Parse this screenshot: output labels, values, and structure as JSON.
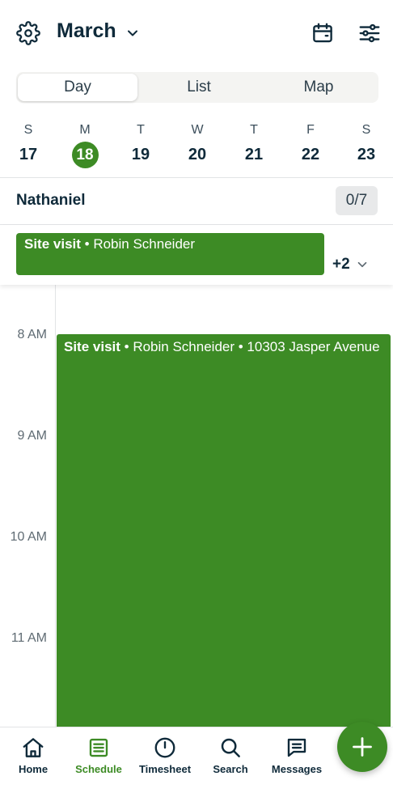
{
  "header": {
    "month": "March"
  },
  "tabs": [
    {
      "label": "Day",
      "active": true
    },
    {
      "label": "List",
      "active": false
    },
    {
      "label": "Map",
      "active": false
    }
  ],
  "week": [
    {
      "letter": "S",
      "date": "17"
    },
    {
      "letter": "M",
      "date": "18",
      "today": true
    },
    {
      "letter": "T",
      "date": "19"
    },
    {
      "letter": "W",
      "date": "20"
    },
    {
      "letter": "T",
      "date": "21"
    },
    {
      "letter": "F",
      "date": "22"
    },
    {
      "letter": "S",
      "date": "23"
    }
  ],
  "assignee": {
    "name": "Nathaniel",
    "count": "0/7"
  },
  "allday": {
    "event_type": "Site visit",
    "event_rest": " • Robin Schneider",
    "more": "+2"
  },
  "timeline": {
    "hours": [
      "8 AM",
      "9 AM",
      "10 AM",
      "11 AM"
    ],
    "event_type": "Site visit",
    "event_rest": " • Robin Schneider • 10303 Jasper Avenue"
  },
  "nav": [
    {
      "label": "Home",
      "icon": "home-icon"
    },
    {
      "label": "Schedule",
      "icon": "schedule-icon",
      "active": true
    },
    {
      "label": "Timesheet",
      "icon": "clock-icon"
    },
    {
      "label": "Search",
      "icon": "search-icon"
    },
    {
      "label": "Messages",
      "icon": "message-icon"
    }
  ],
  "colors": {
    "accent": "#3d8b25",
    "text": "#0f2a3a"
  }
}
